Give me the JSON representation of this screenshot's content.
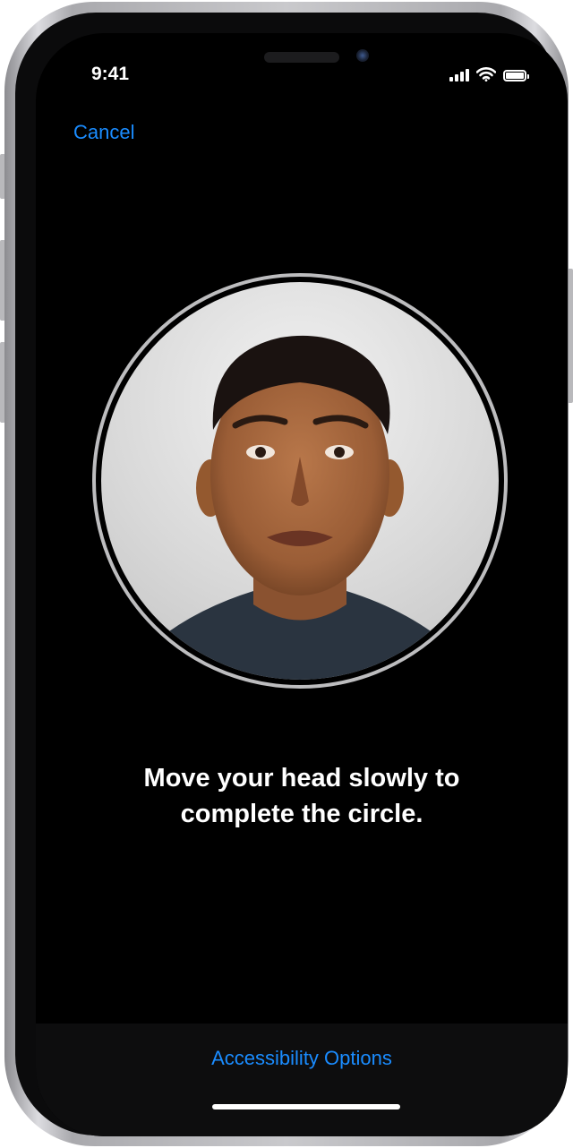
{
  "status_bar": {
    "time": "9:41",
    "icons": [
      "cellular-signal-icon",
      "wifi-icon",
      "battery-icon"
    ]
  },
  "nav": {
    "cancel_label": "Cancel"
  },
  "scan": {
    "instruction_line1": "Move your head slowly to",
    "instruction_line2": "complete the circle.",
    "photo_description_icon": "face-portrait"
  },
  "footer": {
    "accessibility_label": "Accessibility Options"
  },
  "colors": {
    "accent": "#1a8cff",
    "background": "#000000",
    "text": "#ffffff",
    "ring": "#bdbdbf"
  }
}
